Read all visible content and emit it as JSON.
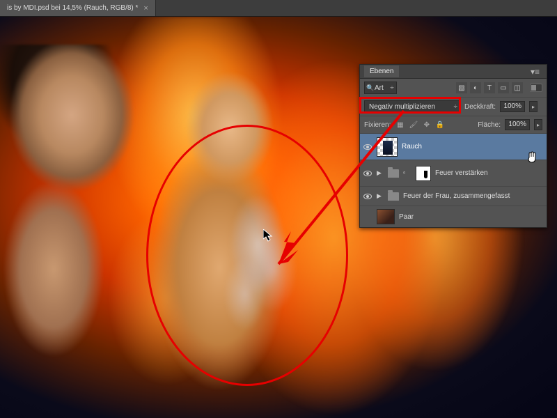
{
  "tab": {
    "title": "is by MDI.psd bei 14,5% (Rauch, RGB/8) *"
  },
  "panel": {
    "title": "Ebenen",
    "filter_label": "Art",
    "blend_mode": "Negativ multiplizieren",
    "opacity_label": "Deckkraft:",
    "opacity_value": "100%",
    "lock_label": "Fixieren:",
    "fill_label": "Fläche:",
    "fill_value": "100%",
    "layers": [
      {
        "name": "Rauch"
      },
      {
        "name": "Feuer verstärken"
      },
      {
        "name": "Feuer der Frau, zusammengefasst"
      },
      {
        "name": "Paar"
      }
    ]
  }
}
